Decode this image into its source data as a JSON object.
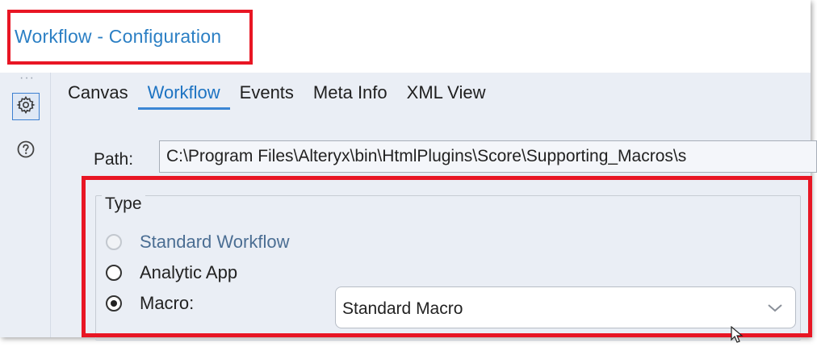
{
  "window": {
    "title": "Workflow - Configuration"
  },
  "rail": {
    "items": [
      {
        "name": "settings",
        "icon": "gear-icon"
      },
      {
        "name": "help",
        "icon": "question-circle-icon"
      }
    ]
  },
  "tabs": [
    {
      "label": "Canvas",
      "active": false
    },
    {
      "label": "Workflow",
      "active": true
    },
    {
      "label": "Events",
      "active": false
    },
    {
      "label": "Meta Info",
      "active": false
    },
    {
      "label": "XML View",
      "active": false
    }
  ],
  "path": {
    "label": "Path:",
    "value": "C:\\Program Files\\Alteryx\\bin\\HtmlPlugins\\Score\\Supporting_Macros\\s"
  },
  "type_group": {
    "legend": "Type",
    "options": [
      {
        "label": "Standard Workflow",
        "selected": false,
        "disabled": true
      },
      {
        "label": "Analytic App",
        "selected": false,
        "disabled": false
      },
      {
        "label": "Macro:",
        "selected": true,
        "disabled": false
      }
    ],
    "macro_select": {
      "value": "Standard Macro"
    }
  },
  "colors": {
    "highlight": "#e81624",
    "accent": "#1d73c2",
    "panel_bg": "#eaeef5"
  }
}
